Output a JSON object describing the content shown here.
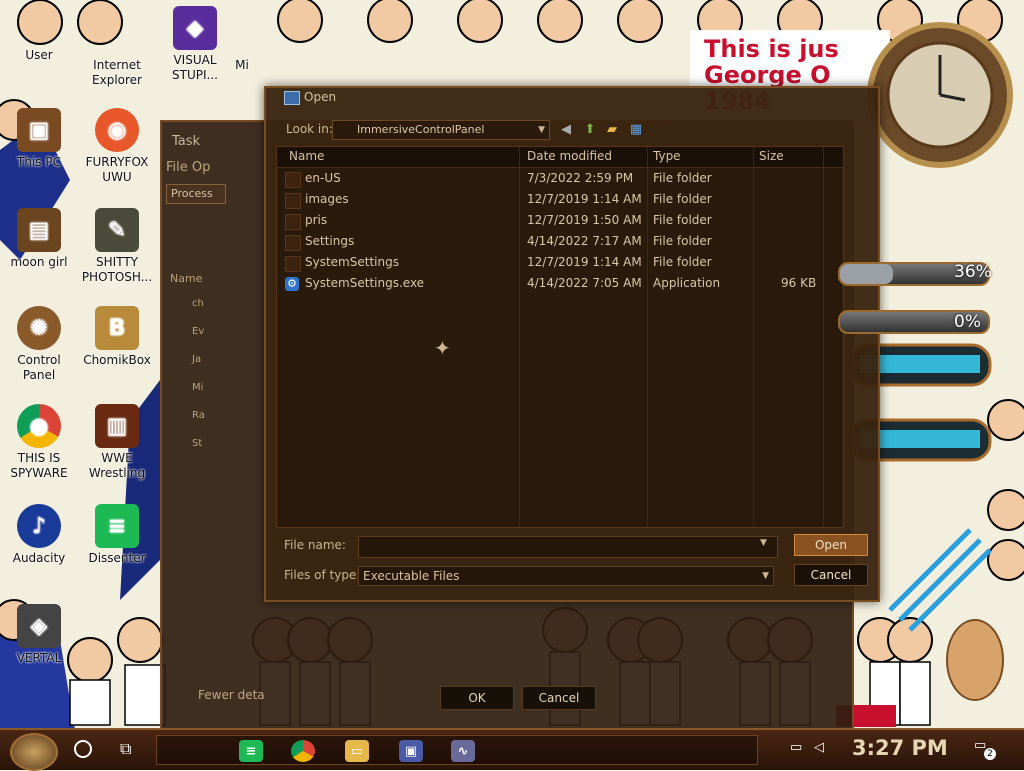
{
  "desktop": {
    "icons": [
      {
        "label": "User"
      },
      {
        "label": "Internet Explorer"
      },
      {
        "label": "VISUAL STUPI..."
      },
      {
        "label": "Mi"
      },
      {
        "label": "This PC"
      },
      {
        "label": "FURRYFOX UWU"
      },
      {
        "label": "moon girl"
      },
      {
        "label": "SHITTY PHOTOSH..."
      },
      {
        "label": "Control Panel"
      },
      {
        "label": "ChomikBox"
      },
      {
        "label": "THIS IS SPYWARE"
      },
      {
        "label": "WWE Wrestling"
      },
      {
        "label": "Audacity"
      },
      {
        "label": "Dissenter"
      },
      {
        "label": "VERTAL"
      }
    ],
    "poster_text": [
      "This is jus",
      "George O",
      "1984"
    ]
  },
  "background_window": {
    "title": "Task",
    "menu": "File  Op",
    "tab": "Process",
    "column": "Name",
    "process_rows": [
      "ch",
      "Ev",
      "Ja",
      "Mi",
      "Ra",
      "St"
    ],
    "footer_text": "Fewer deta",
    "buttons": [
      "OK",
      "Cancel"
    ]
  },
  "dialog": {
    "title": "Open",
    "look_in_label": "Look in:",
    "look_in_value": "ImmersiveControlPanel",
    "columns": [
      "Name",
      "Date modified",
      "Type",
      "Size"
    ],
    "rows": [
      {
        "name": "en-US",
        "date": "7/3/2022 2:59 PM",
        "type": "File folder",
        "size": "",
        "kind": "folder"
      },
      {
        "name": "images",
        "date": "12/7/2019 1:14 AM",
        "type": "File folder",
        "size": "",
        "kind": "folder"
      },
      {
        "name": "pris",
        "date": "12/7/2019 1:50 AM",
        "type": "File folder",
        "size": "",
        "kind": "folder"
      },
      {
        "name": "Settings",
        "date": "4/14/2022 7:17 AM",
        "type": "File folder",
        "size": "",
        "kind": "folder"
      },
      {
        "name": "SystemSettings",
        "date": "12/7/2019 1:14 AM",
        "type": "File folder",
        "size": "",
        "kind": "folder"
      },
      {
        "name": "SystemSettings.exe",
        "date": "4/14/2022 7:05 AM",
        "type": "Application",
        "size": "96 KB",
        "kind": "app"
      }
    ],
    "file_name_label": "File name:",
    "file_name_value": "",
    "files_of_type_label": "Files of type:",
    "files_of_type_value": "Executable Files",
    "open_label": "Open",
    "cancel_label": "Cancel"
  },
  "widgets": {
    "cpu_percent": "36%",
    "mem_percent": "0%",
    "cpu_level": 0.36,
    "mem_level": 0.0
  },
  "taskbar": {
    "time": "3:27 PM",
    "notification_count": "2",
    "apps": [
      "spreadsheet-app",
      "chrome",
      "file-explorer",
      "remote-desktop",
      "task-manager"
    ]
  },
  "colors": {
    "dialog_bg": "#3a2410",
    "accent": "#d48a3a",
    "text": "#d8c7a7"
  }
}
